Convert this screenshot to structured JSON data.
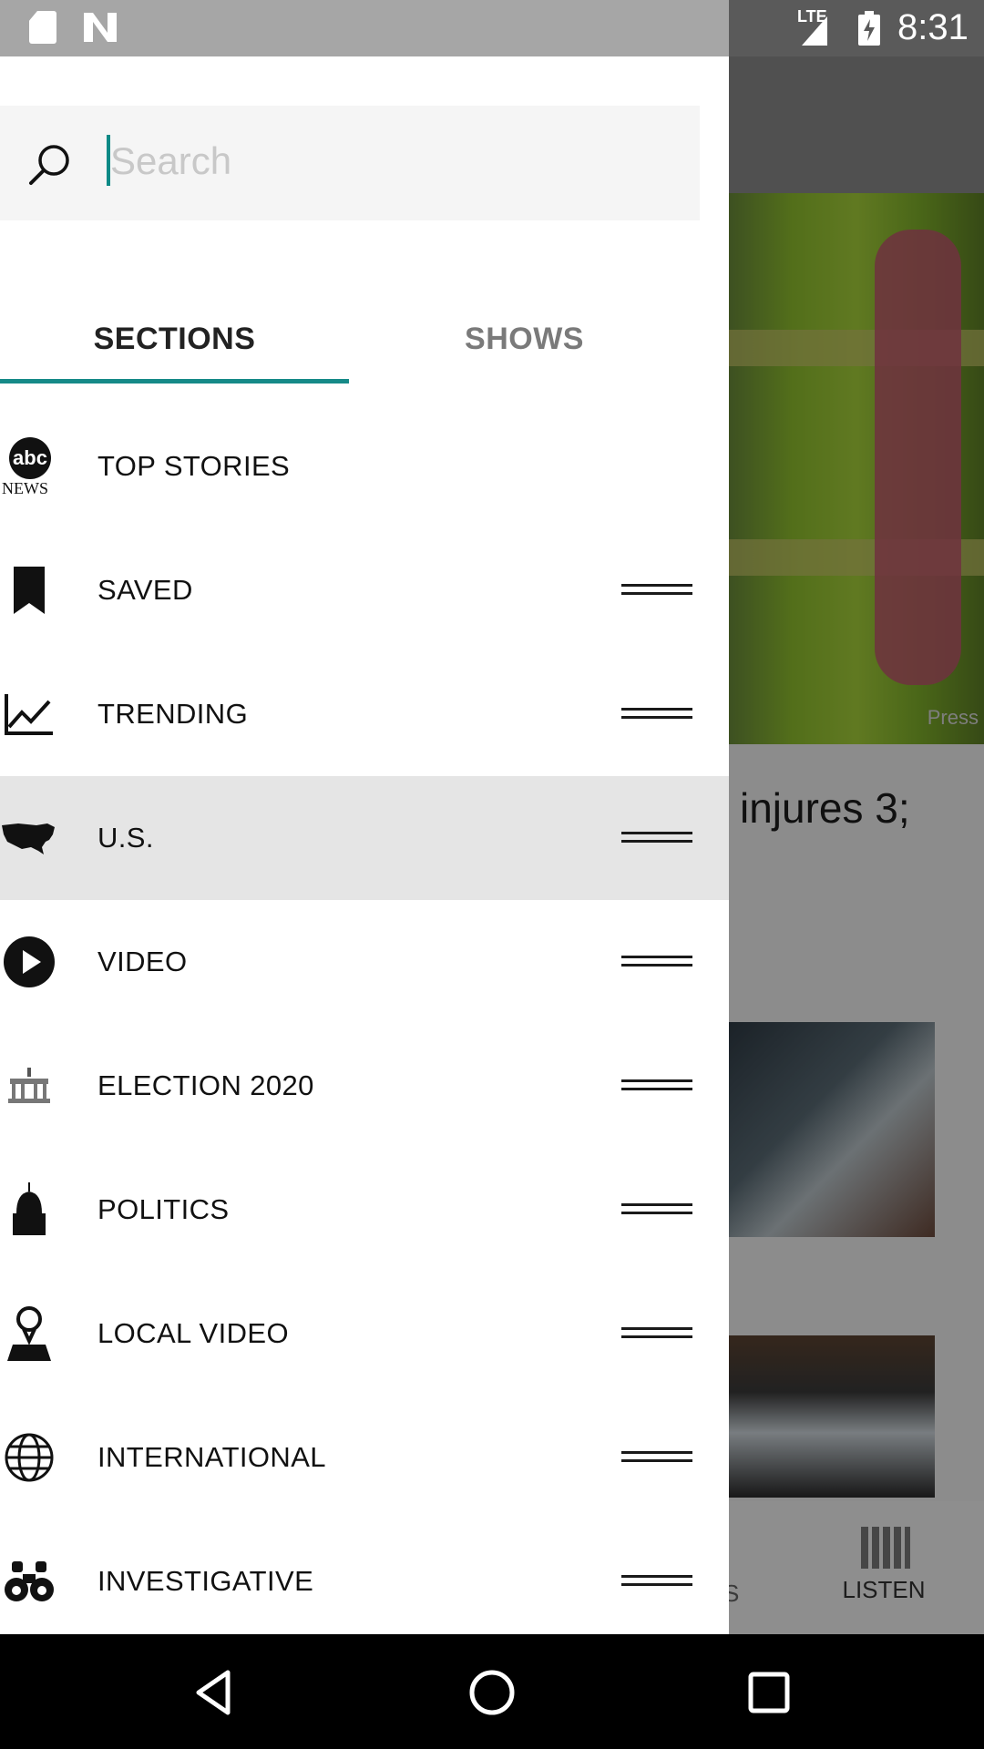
{
  "status_bar": {
    "network": "LTE",
    "time": "8:31",
    "icons": [
      "sd-card-icon",
      "n-notification-icon",
      "signal-icon",
      "battery-charging-icon"
    ]
  },
  "background": {
    "photo_credit": "Press",
    "headline_fragment": "injures 3;",
    "bottom_tab_partial": "S",
    "listen_label": "LISTEN"
  },
  "drawer": {
    "search": {
      "placeholder": "Search",
      "value": ""
    },
    "tabs": [
      {
        "label": "SECTIONS",
        "selected": true
      },
      {
        "label": "SHOWS",
        "selected": false
      }
    ],
    "accent_color": "#168a88",
    "sections": [
      {
        "label": "TOP STORIES",
        "icon": "abc-news-logo",
        "draggable": false,
        "selected": false
      },
      {
        "label": "SAVED",
        "icon": "bookmark-icon",
        "draggable": true,
        "selected": false
      },
      {
        "label": "TRENDING",
        "icon": "trending-chart-icon",
        "draggable": true,
        "selected": false
      },
      {
        "label": "U.S.",
        "icon": "us-map-icon",
        "draggable": true,
        "selected": true
      },
      {
        "label": "VIDEO",
        "icon": "play-circle-icon",
        "draggable": true,
        "selected": false
      },
      {
        "label": "ELECTION 2020",
        "icon": "government-building-icon",
        "draggable": true,
        "selected": false
      },
      {
        "label": "POLITICS",
        "icon": "capitol-dome-icon",
        "draggable": true,
        "selected": false
      },
      {
        "label": "LOCAL VIDEO",
        "icon": "location-pin-icon",
        "draggable": true,
        "selected": false
      },
      {
        "label": "INTERNATIONAL",
        "icon": "globe-icon",
        "draggable": true,
        "selected": false
      },
      {
        "label": "INVESTIGATIVE",
        "icon": "binoculars-icon",
        "draggable": true,
        "selected": false
      }
    ],
    "abc_logo": {
      "mark": "abc",
      "word": "NEWS"
    }
  },
  "nav_bar": {
    "buttons": [
      "back-icon",
      "home-icon",
      "recents-icon"
    ]
  }
}
